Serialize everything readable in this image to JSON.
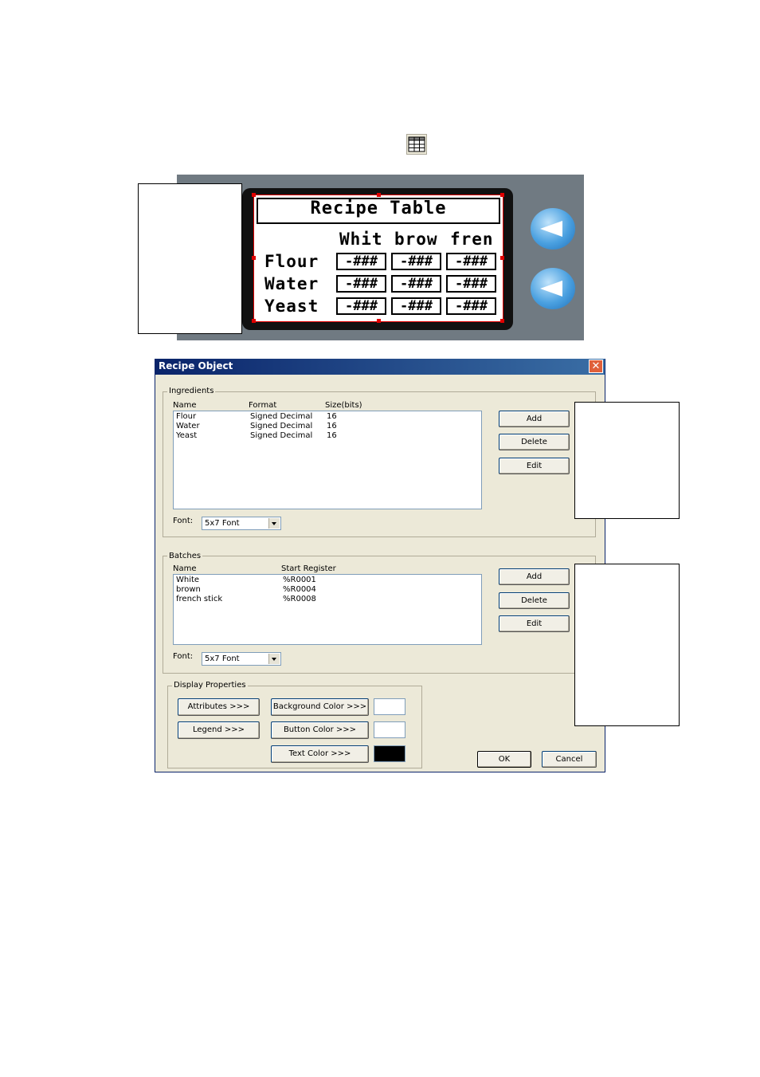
{
  "hmi": {
    "title": "Recipe Table",
    "batch_headers": [
      "Whit",
      "brow",
      "fren"
    ],
    "rows": [
      "Flour",
      "Water",
      "Yeast"
    ],
    "cell_value": "-###"
  },
  "dialog": {
    "title": "Recipe Object",
    "close_glyph": "✕",
    "ingredients": {
      "group_label": "Ingredients",
      "columns": [
        "Name",
        "Format",
        "Size(bits)"
      ],
      "items": [
        {
          "name": "Flour",
          "format": "Signed Decimal",
          "size": "16"
        },
        {
          "name": "Water",
          "format": "Signed Decimal",
          "size": "16"
        },
        {
          "name": "Yeast",
          "format": "Signed Decimal",
          "size": "16"
        }
      ],
      "font_label": "Font:",
      "font_value": "5x7 Font",
      "add": "Add",
      "delete": "Delete",
      "edit": "Edit"
    },
    "batches": {
      "group_label": "Batches",
      "columns": [
        "Name",
        "Start Register"
      ],
      "items": [
        {
          "name": "White",
          "register": "%R0001"
        },
        {
          "name": "brown",
          "register": "%R0004"
        },
        {
          "name": "french stick",
          "register": "%R0008"
        }
      ],
      "font_label": "Font:",
      "font_value": "5x7 Font",
      "add": "Add",
      "delete": "Delete",
      "edit": "Edit"
    },
    "display": {
      "group_label": "Display Properties",
      "attributes": "Attributes >>>",
      "legend": "Legend >>>",
      "background_color": "Background Color >>>",
      "button_color": "Button Color >>>",
      "text_color": "Text Color >>>",
      "background_swatch": "#ffffff",
      "button_swatch": "#ffffff",
      "text_swatch": "#000000"
    },
    "ok": "OK",
    "cancel": "Cancel"
  }
}
